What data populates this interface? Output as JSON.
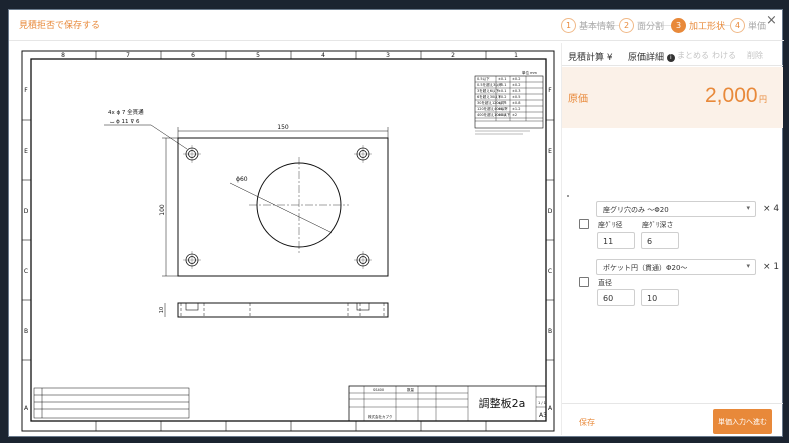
{
  "header": {
    "save_link": "見積拒否で保存する",
    "steps": [
      {
        "num": "1",
        "label": "基本情報"
      },
      {
        "num": "2",
        "label": "面分割"
      },
      {
        "num": "3",
        "label": "加工形状"
      },
      {
        "num": "4",
        "label": "単価"
      }
    ],
    "close": "×"
  },
  "drawing": {
    "col_labels": [
      "8",
      "7",
      "6",
      "5",
      "4",
      "3",
      "2",
      "1"
    ],
    "row_labels": [
      "A",
      "B",
      "C",
      "D",
      "E",
      "F"
    ],
    "hole_note": "4x ϕ 7 全貫通",
    "hole_note2": "⌴ ϕ 11 ⊽ 6",
    "dim_width": "150",
    "dim_height": "100",
    "dim_diameter": "ϕ60",
    "dim_thickness": "10",
    "part_title": "調整板2a",
    "material": "SS400",
    "quantity_label": "数量",
    "sheet_label": "A3",
    "sheet_num": "1 / 1",
    "company": "株式会社カブク",
    "tolerance_header": "単位 mm",
    "tolerance_rows": [
      [
        "0.5以下",
        "±0.1",
        "±0.2"
      ],
      [
        "0.5を超え3以下",
        "±0.1",
        "±0.2"
      ],
      [
        "3を超え6以下",
        "±0.1",
        "±0.3"
      ],
      [
        "6を超え30以下",
        "±0.2",
        "±0.5"
      ],
      [
        "30を超え120以下",
        "±0.3",
        "±0.8"
      ],
      [
        "120を超え400以下",
        "±0.5",
        "±1.2"
      ],
      [
        "400を超え1000以下",
        "±0.8",
        "±2"
      ]
    ]
  },
  "panel": {
    "tabs": {
      "estimate": "見積計算 ¥",
      "cost_detail": "原価詳細",
      "merge": "まとめる",
      "split": "わける",
      "delete": "削除"
    },
    "price_label": "原価",
    "price_value": "2,000",
    "price_unit": "円",
    "shapes": [
      {
        "select": "座グリ穴のみ ～Φ20",
        "multiplier": "× 4",
        "field_labels": [
          "座ｸﾞﾘ径",
          "座ｸﾞﾘ深さ"
        ],
        "values": [
          "11",
          "6"
        ]
      },
      {
        "select": "ポケット円（貫通）Φ20～",
        "multiplier": "× 1",
        "field_labels": [
          "直径"
        ],
        "values": [
          "60",
          "10"
        ]
      }
    ],
    "footer_save": "保存",
    "footer_next": "単価入力へ進む"
  },
  "colors": {
    "accent": "#e8893a",
    "backdrop": "#1b2430"
  }
}
